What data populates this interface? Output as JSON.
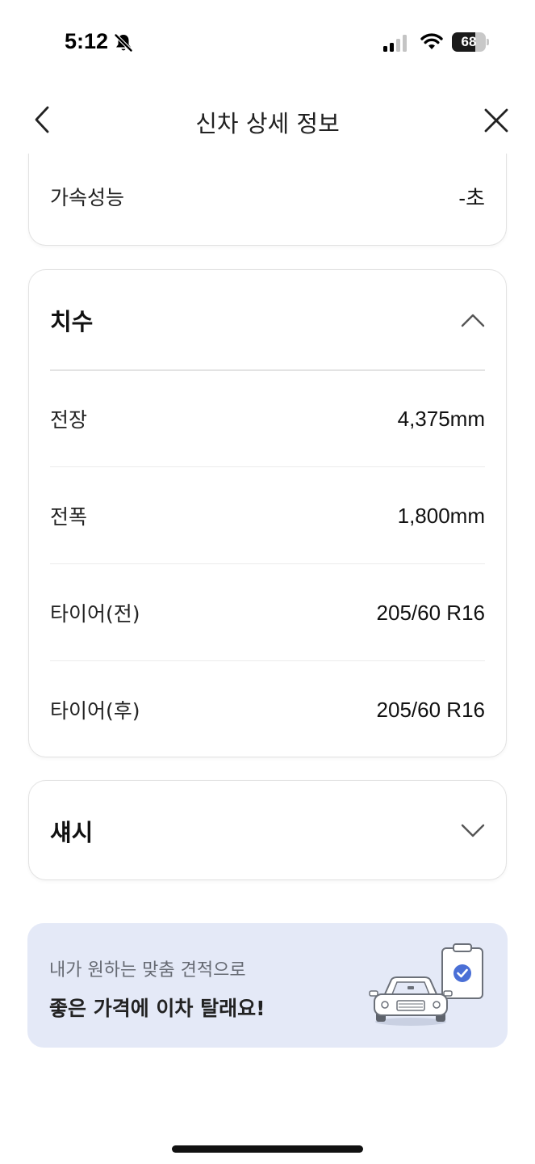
{
  "status_bar": {
    "time": "5:12",
    "battery_level": "68",
    "battery_fraction": 0.68,
    "icons": [
      "bell-slash-icon",
      "cellular-signal-icon",
      "wifi-icon",
      "battery-icon"
    ]
  },
  "header": {
    "title": "신차 상세 정보",
    "back_icon": "chevron-left-icon",
    "close_icon": "close-icon"
  },
  "performance": {
    "acceleration_label": "가속성능",
    "acceleration_value": "-초"
  },
  "dimensions": {
    "title": "치수",
    "expanded": true,
    "toggle_icon": "chevron-up-icon",
    "rows": [
      {
        "label": "전장",
        "value": "4,375mm"
      },
      {
        "label": "전폭",
        "value": "1,800mm"
      },
      {
        "label": "타이어(전)",
        "value": "205/60 R16"
      },
      {
        "label": "타이어(후)",
        "value": "205/60 R16"
      }
    ]
  },
  "chassis": {
    "title": "섀시",
    "expanded": false,
    "toggle_icon": "chevron-down-icon"
  },
  "promo": {
    "subtitle": "내가 원하는 맞춤 견적으로",
    "title": "좋은 가격에 이차 탈래요!",
    "illustration": "car-with-clipboard-illustration"
  },
  "colors": {
    "promo_background": "#e4e9f7",
    "accent_blue": "#4a6fd6",
    "card_border": "#e2e2e2"
  }
}
